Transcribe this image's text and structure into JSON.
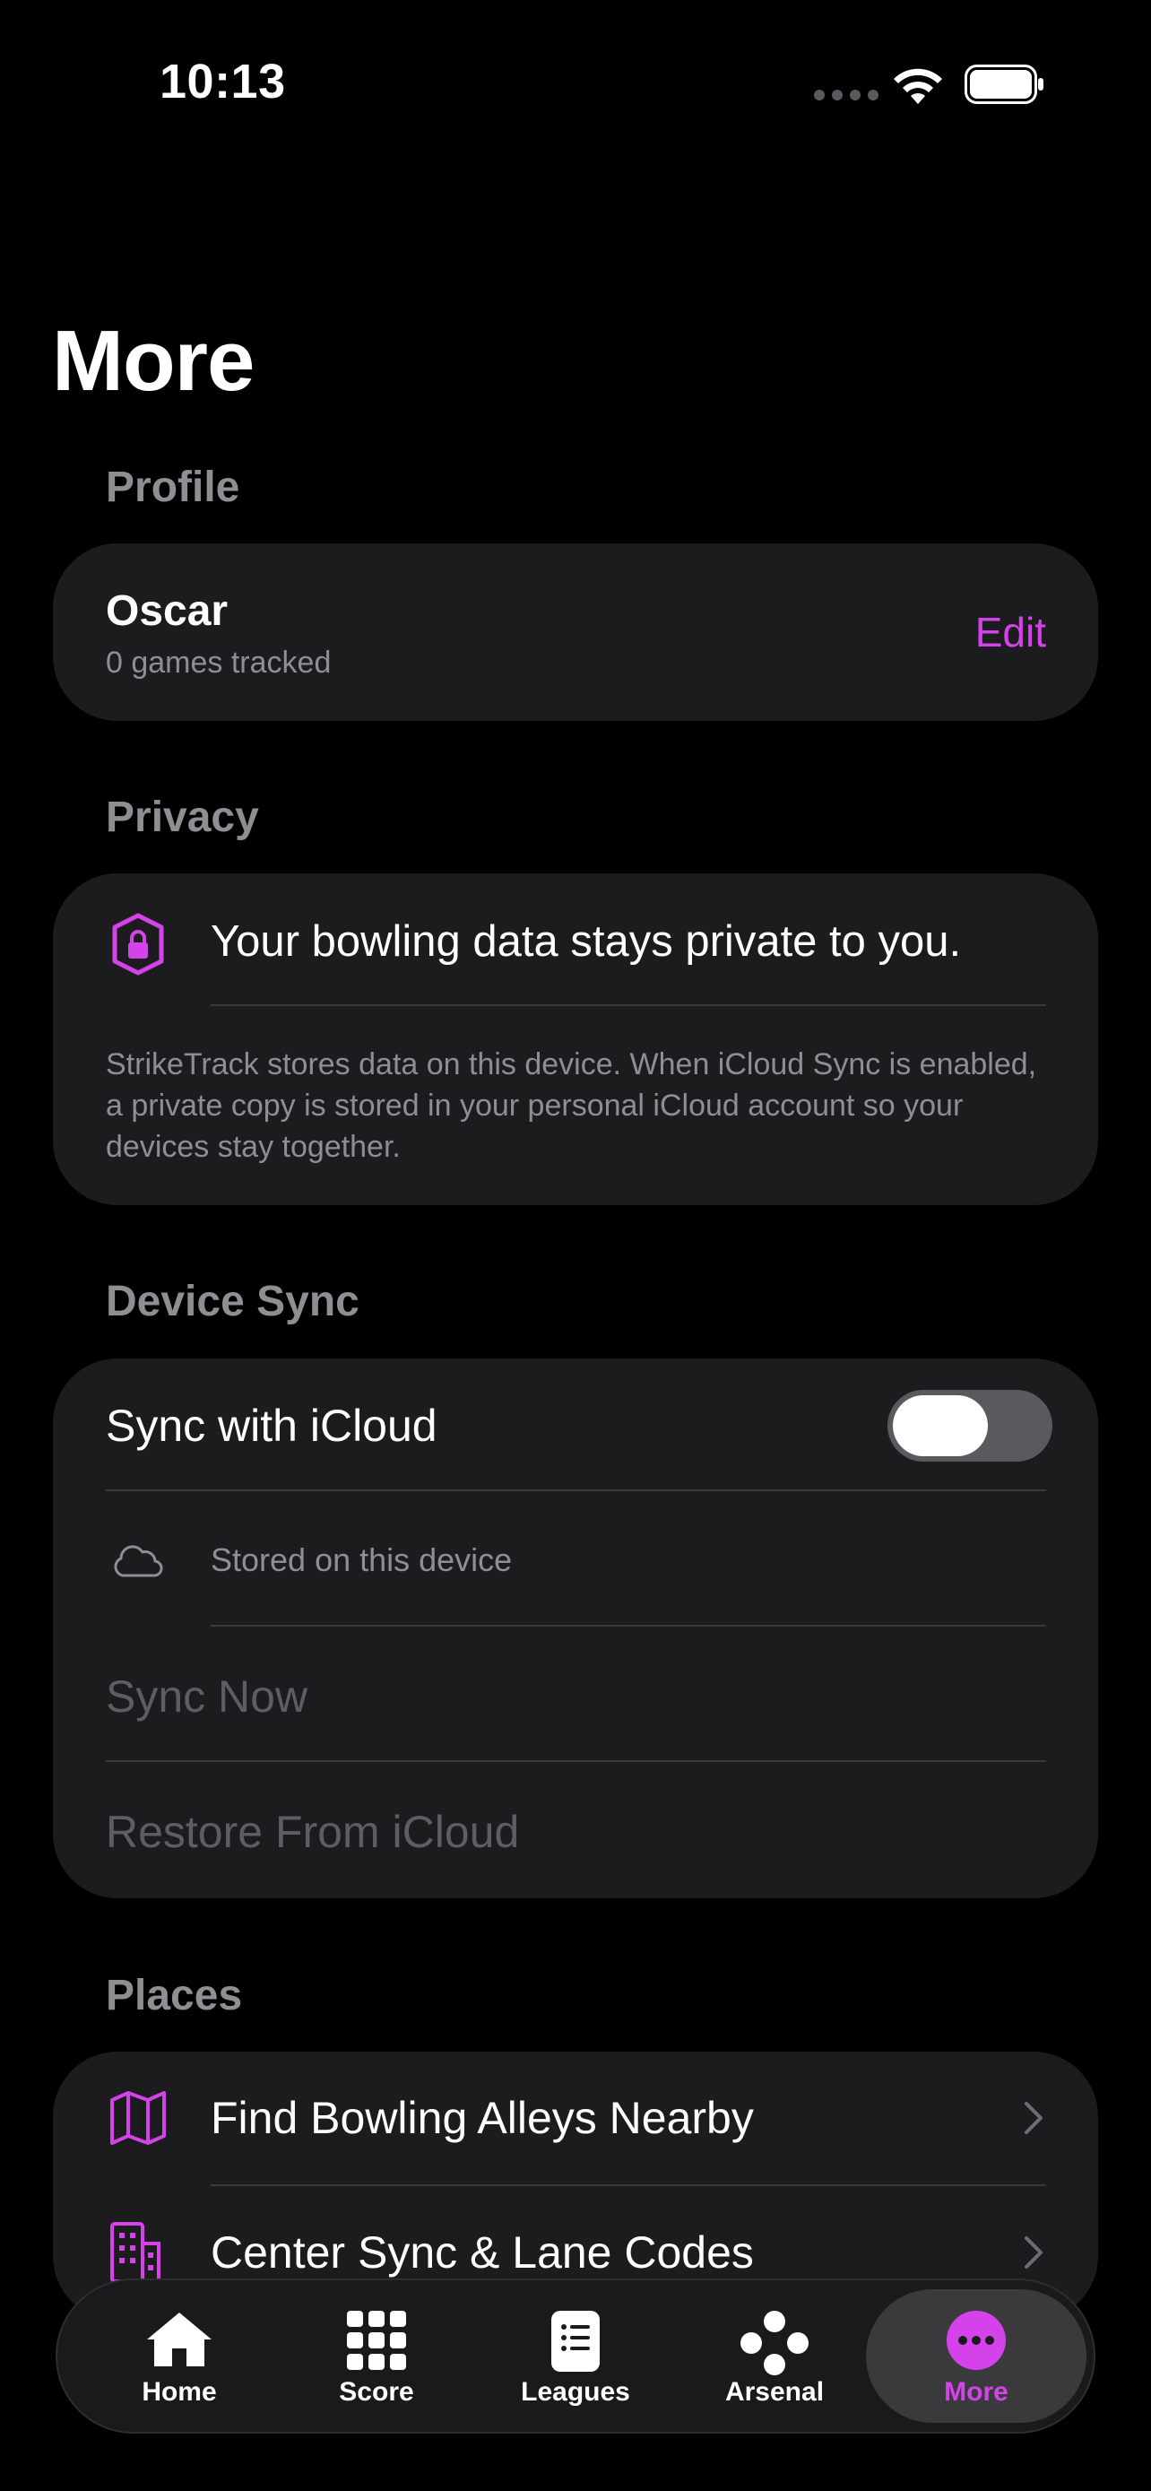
{
  "status_bar": {
    "time": "10:13"
  },
  "page": {
    "title": "More"
  },
  "profile": {
    "header": "Profile",
    "name": "Oscar",
    "subtitle": "0 games tracked",
    "edit_label": "Edit"
  },
  "privacy": {
    "header": "Privacy",
    "headline": "Your bowling data stays private to you.",
    "body": "StrikeTrack stores data on this device. When iCloud Sync is enabled, a private copy is stored in your personal iCloud account so your devices stay together."
  },
  "device_sync": {
    "header": "Device Sync",
    "toggle_label": "Sync with iCloud",
    "toggle_on": false,
    "storage_status": "Stored on this device",
    "sync_now_label": "Sync Now",
    "restore_label": "Restore From iCloud"
  },
  "places": {
    "header": "Places",
    "items": [
      {
        "label": "Find Bowling Alleys Nearby",
        "icon": "map-icon"
      },
      {
        "label": "Center Sync & Lane Codes",
        "icon": "building-icon"
      }
    ]
  },
  "tab_bar": {
    "tabs": [
      {
        "label": "Home",
        "icon": "house-icon",
        "active": false
      },
      {
        "label": "Score",
        "icon": "grid-icon",
        "active": false
      },
      {
        "label": "Leagues",
        "icon": "list-icon",
        "active": false
      },
      {
        "label": "Arsenal",
        "icon": "bowling-pins-icon",
        "active": false
      },
      {
        "label": "More",
        "icon": "ellipsis-circle-icon",
        "active": true
      }
    ]
  },
  "colors": {
    "accent": "#d443e9",
    "background": "#000000",
    "card": "#1c1c1e",
    "secondary_text": "#8e8e93"
  }
}
